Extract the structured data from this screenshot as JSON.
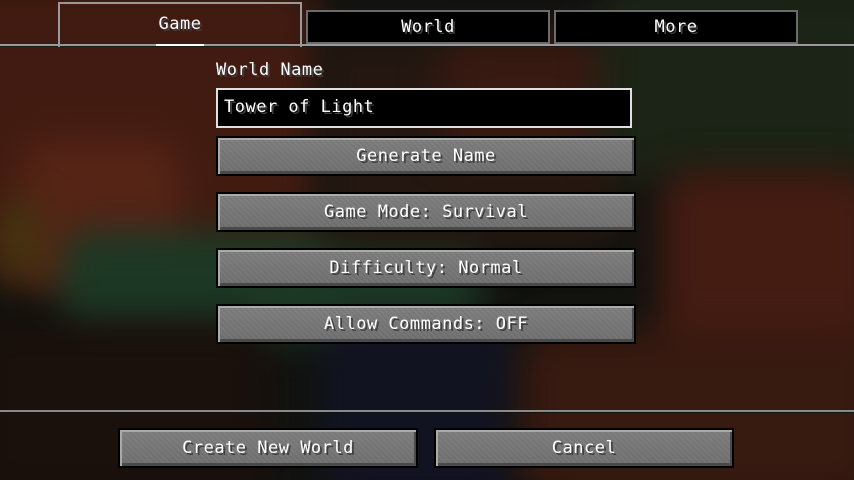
{
  "tabs": [
    {
      "label": "Game",
      "active": true
    },
    {
      "label": "World",
      "active": false
    },
    {
      "label": "More",
      "active": false
    }
  ],
  "world_name": {
    "label": "World Name",
    "value": "Tower of Light"
  },
  "buttons": {
    "generate_name": "Generate Name",
    "game_mode": "Game Mode: Survival",
    "difficulty": "Difficulty: Normal",
    "allow_commands": "Allow Commands: OFF"
  },
  "footer": {
    "create": "Create New World",
    "cancel": "Cancel"
  },
  "colors": {
    "button_face": "#6f6f6f",
    "input_bg": "#000000",
    "text": "#ffffff"
  }
}
